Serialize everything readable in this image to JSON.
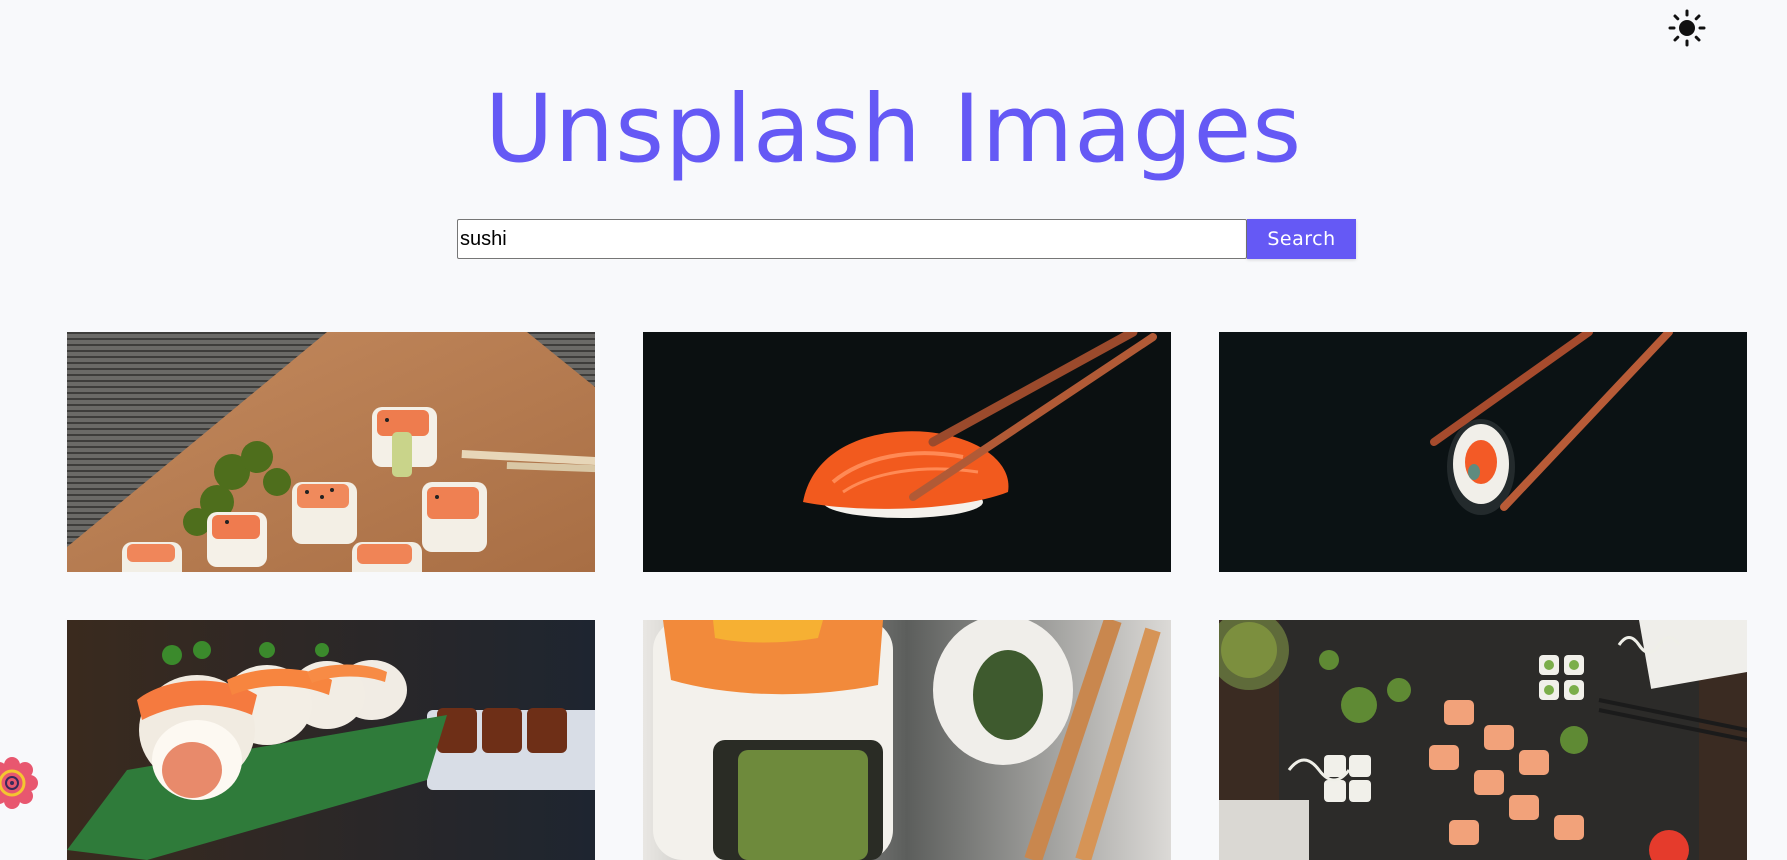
{
  "header": {
    "theme_toggle_icon": "sun-icon",
    "title": "Unsplash Images"
  },
  "search": {
    "value": "sushi",
    "button_label": "Search"
  },
  "gallery": {
    "images": [
      {
        "subject": "salmon sushi rolls with chopsticks on wooden board"
      },
      {
        "subject": "salmon nigiri held by chopsticks on dark background"
      },
      {
        "subject": "sushi roll held by chopsticks on dark background"
      },
      {
        "subject": "row of salmon sushi rolls on plate"
      },
      {
        "subject": "close-up salmon sushi roll with chopsticks"
      },
      {
        "subject": "assorted sushi platter from above"
      }
    ]
  },
  "badge": {
    "icon": "flower-badge-icon",
    "colors": {
      "outer": "#e8576f",
      "inner": "#f4c531"
    }
  },
  "colors": {
    "accent": "#6559f5",
    "background": "#f8f9fb"
  }
}
